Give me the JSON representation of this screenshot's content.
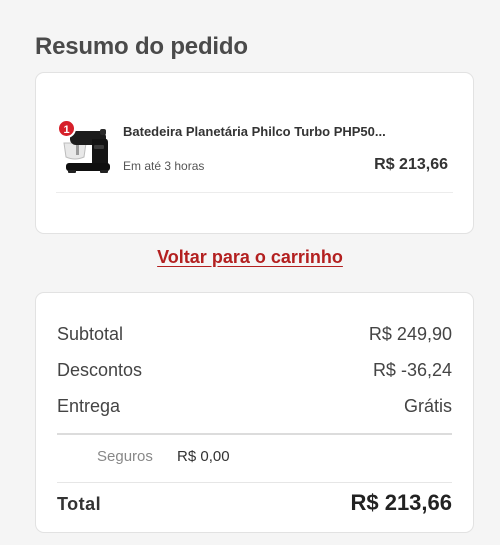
{
  "page": {
    "title": "Resumo do pedido"
  },
  "cart_item": {
    "quantity": "1",
    "name": "Batedeira Planetária Philco Turbo PHP50...",
    "delivery": "Em até 3 horas",
    "price": "R$ 213,66",
    "image_icon": "stand-mixer-product-image"
  },
  "links": {
    "back_to_cart": "Voltar para o carrinho"
  },
  "summary": {
    "subtotal_label": "Subtotal",
    "subtotal_value": "R$ 249,90",
    "discount_label": "Descontos",
    "discount_value": "R$ -36,24",
    "delivery_label": "Entrega",
    "delivery_value": "Grátis",
    "insurance_label": "Seguros",
    "insurance_value": "R$ 0,00",
    "total_label": "Total",
    "total_value": "R$ 213,66"
  },
  "colors": {
    "accent_red": "#b32020",
    "badge_red": "#d6202a",
    "background": "#f5f5f5",
    "card": "#ffffff"
  }
}
